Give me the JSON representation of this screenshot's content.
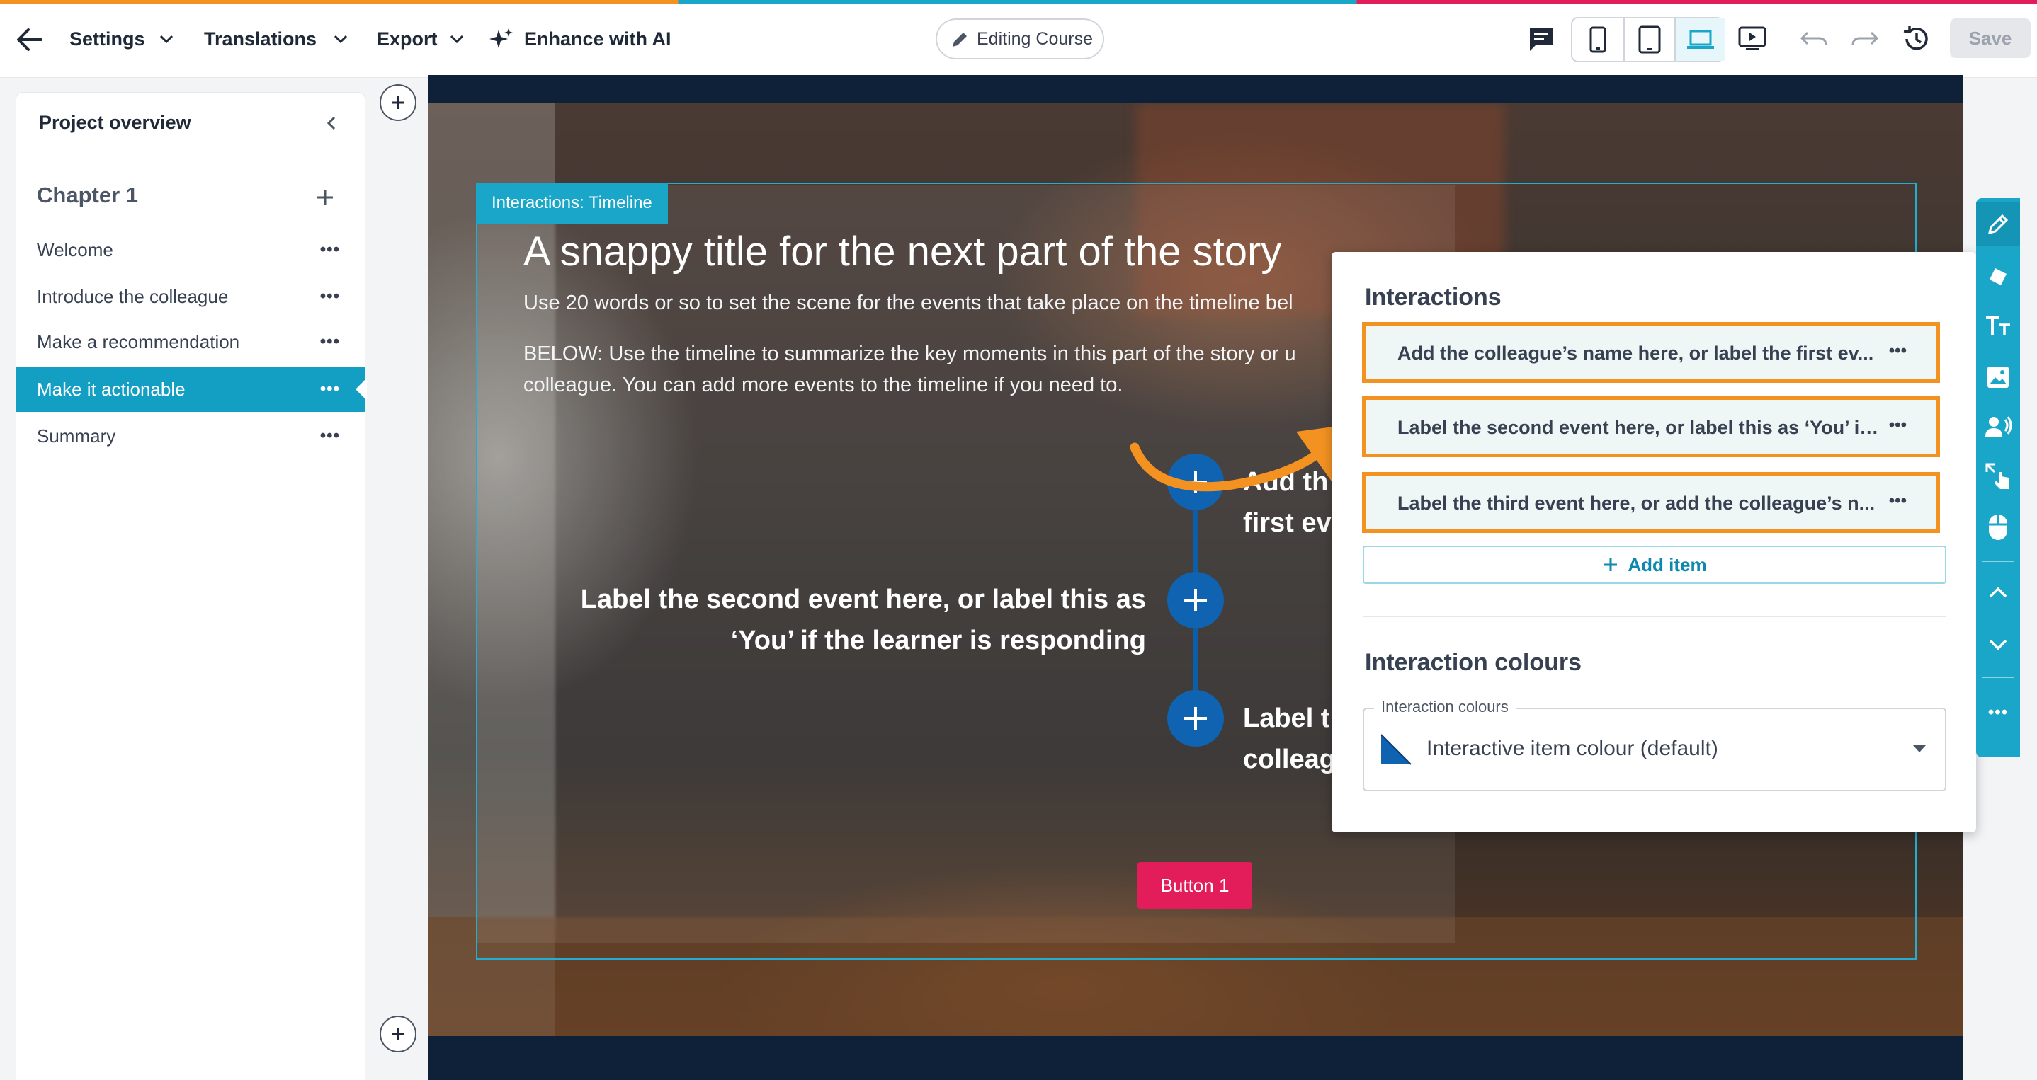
{
  "colors": {
    "brand_teal": "#1aa6c8",
    "highlight_orange": "#f39221",
    "timeline_blue": "#0f63b0",
    "button_pink": "#e21d5a",
    "top_stripe": [
      "#f39221",
      "#1aa6c8",
      "#e21d5a"
    ]
  },
  "toolbar": {
    "back_icon": "arrow-left-icon",
    "settings_label": "Settings",
    "translations_label": "Translations",
    "export_label": "Export",
    "enhance_label": "Enhance with AI",
    "editing_label": "Editing Course",
    "save_label": "Save",
    "icons": [
      "comment-icon",
      "phone-icon",
      "tablet-icon",
      "laptop-icon",
      "preview-icon",
      "undo-icon",
      "redo-icon",
      "history-icon"
    ],
    "active_device": "laptop"
  },
  "sidebar": {
    "header": "Project overview",
    "chapter": "Chapter 1",
    "items": [
      {
        "label": "Welcome",
        "active": false
      },
      {
        "label": "Introduce the colleague",
        "active": false
      },
      {
        "label": "Make a recommendation",
        "active": false
      },
      {
        "label": "Make it actionable",
        "active": true
      },
      {
        "label": "Summary",
        "active": false
      }
    ]
  },
  "slide": {
    "frame_label": "Interactions: Timeline",
    "title": "A snappy title for the next part of the story",
    "para1": "Use 20 words or so to set the scene for the events that take place on the timeline bel",
    "para2_line1": "BELOW: Use the timeline to summarize the key moments in this part of the story or u",
    "para2_line2": "colleague. You can add more events to the timeline if you need to.",
    "event1_line1": "Add th",
    "event1_line2": "first ev",
    "event2_line1": "Label the second event here, or label this as",
    "event2_line2": "‘You’ if the learner is responding",
    "event3_line1": "Label t",
    "event3_line2": "colleag",
    "button_label": "Button 1"
  },
  "interactions_panel": {
    "title": "Interactions",
    "items": [
      "Add the colleague’s name here, or label the first ev...",
      "Label the second event here, or label this as ‘You’ if ...",
      "Label the third event here, or add the colleague’s n..."
    ],
    "add_item_label": "Add item",
    "colours_title": "Interaction colours",
    "colours_field_label": "Interaction colours",
    "colours_value": "Interactive item colour (default)"
  },
  "right_toolbar": {
    "icons": [
      "edit-pencil-icon",
      "eraser-icon",
      "text-size-icon",
      "image-icon",
      "speaker-icon",
      "touch-resize-icon",
      "mouse-icon",
      "chevron-up-icon",
      "chevron-down-icon",
      "more-icon"
    ]
  }
}
